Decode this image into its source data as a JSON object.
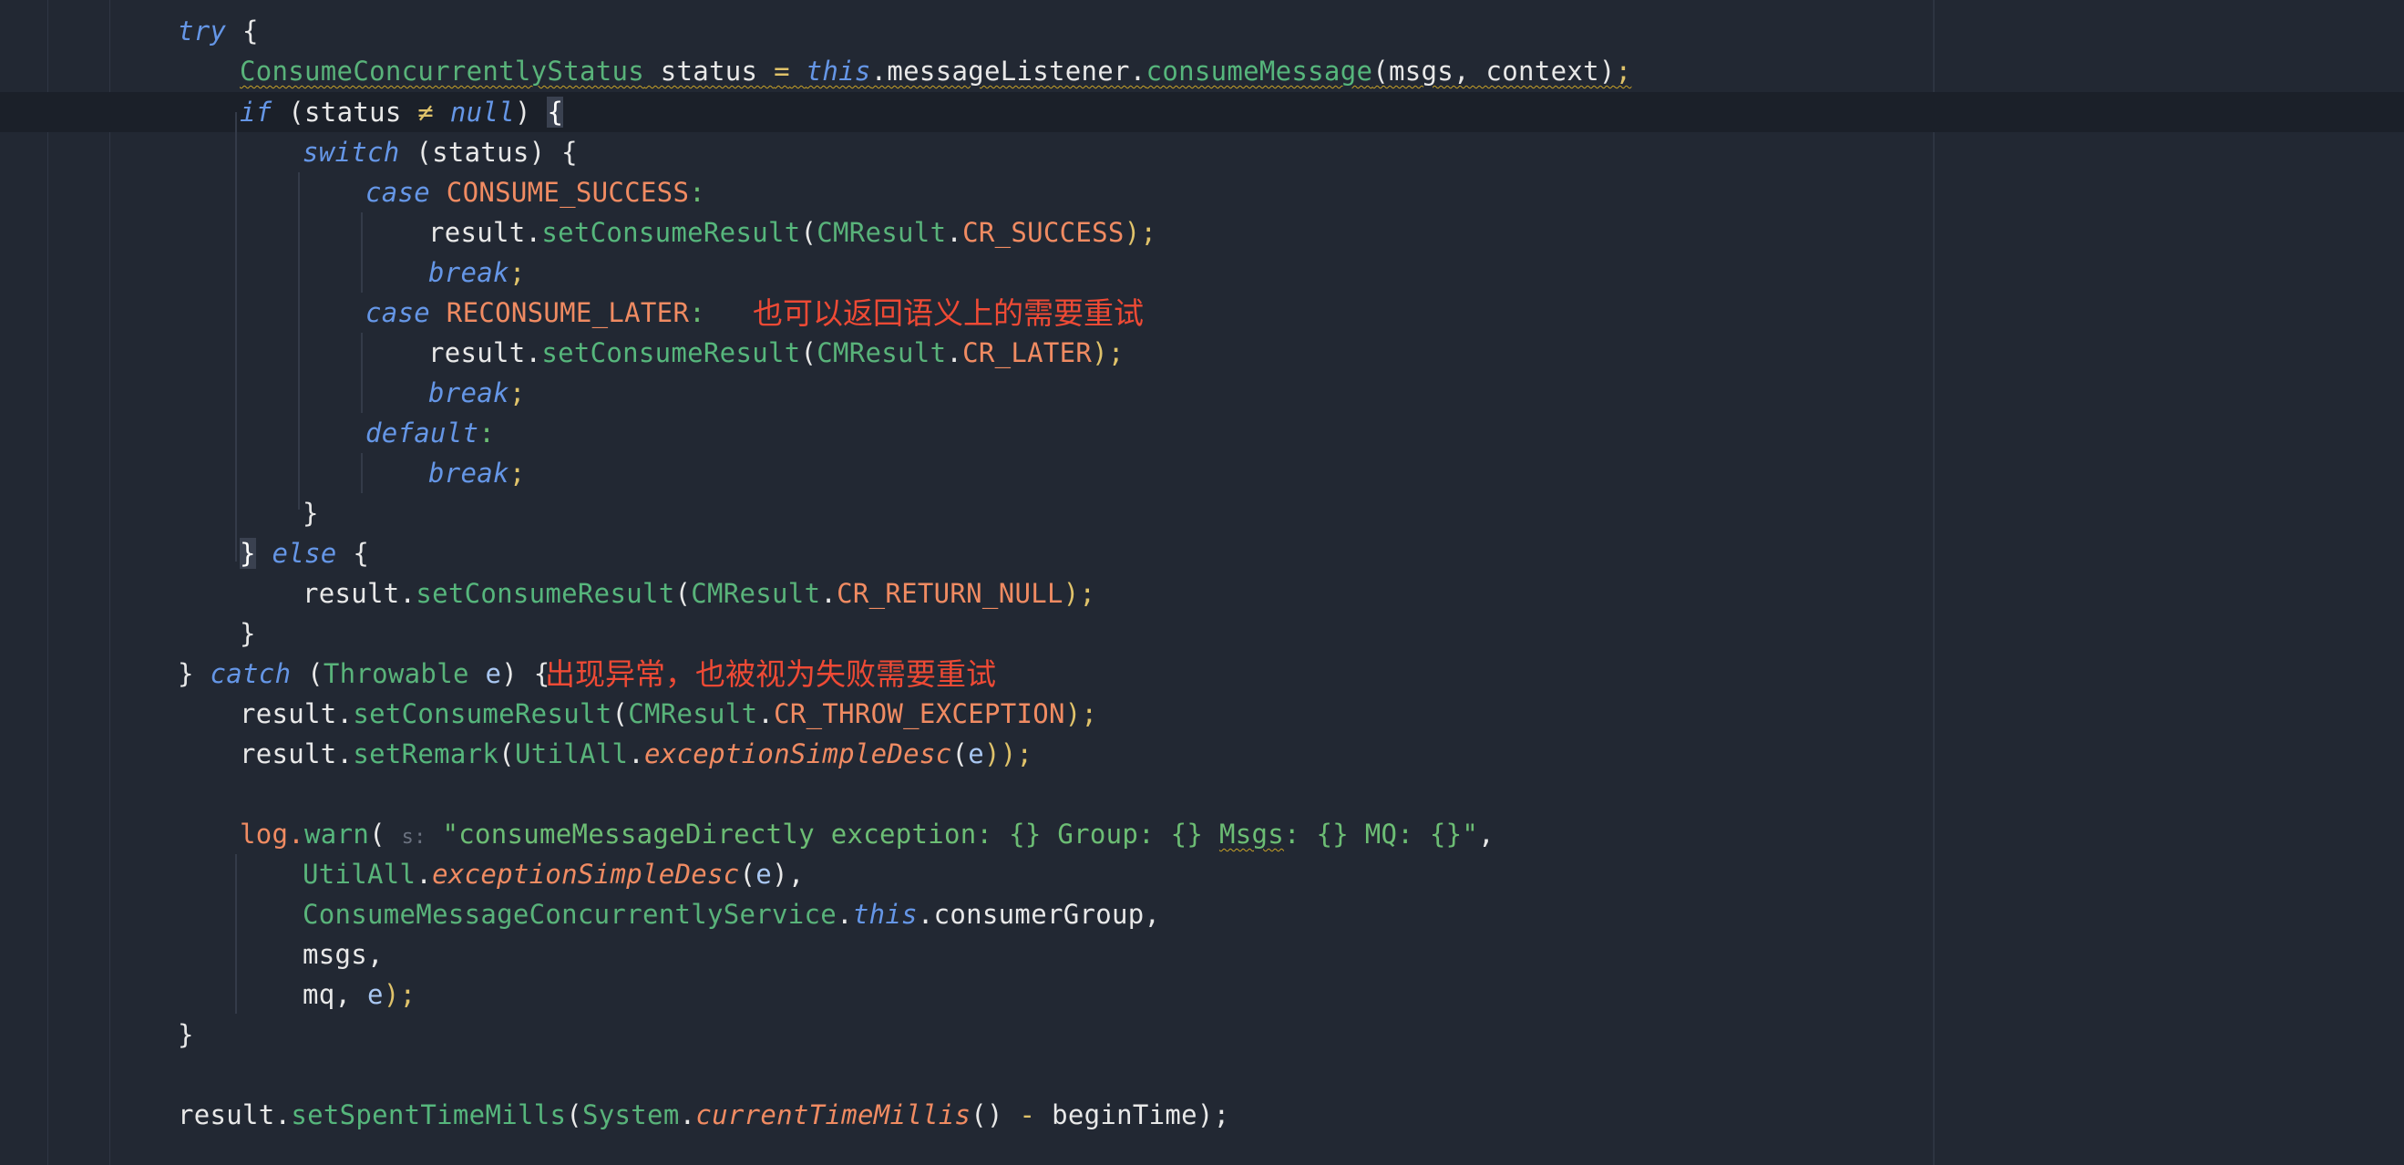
{
  "editor": {
    "colors": {
      "background": "#222833",
      "current_line": "#1b2029",
      "keyword": "#6596e6",
      "type": "#59b37a",
      "constant": "#f08b62",
      "string": "#6cbd74",
      "annotation": "#ee4a35"
    },
    "code": {
      "l1": {
        "kw_try": "try",
        "brace": " {"
      },
      "l2": {
        "type": "ConsumeConcurrentlyStatus",
        "var": " status ",
        "assign": "=",
        "sp": " ",
        "kw_this": "this",
        "member": ".messageListener.",
        "method": "consumeMessage",
        "args": "(msgs, context)",
        "semi": ";"
      },
      "l3": {
        "kw_if": "if",
        "cond_open": " (status ",
        "neq": "≠",
        "sp": " ",
        "kw_null": "null",
        "cond_close": ") ",
        "brace": "{"
      },
      "l4": {
        "kw_switch": "switch",
        "rest": " (status) {"
      },
      "l5": {
        "kw_case": "case",
        "const": " CONSUME_SUCCESS",
        "colon": ":"
      },
      "l6": {
        "obj": "result.",
        "method": "setConsumeResult",
        "open": "(",
        "type": "CMResult",
        "dot": ".",
        "const": "CR_SUCCESS",
        "close": ");"
      },
      "l7": {
        "kw_break": "break",
        "semi": ";"
      },
      "l8": {
        "kw_case": "case",
        "const": " RECONSUME_LATER",
        "colon": ":"
      },
      "l9": {
        "obj": "result.",
        "method": "setConsumeResult",
        "open": "(",
        "type": "CMResult",
        "dot": ".",
        "const": "CR_LATER",
        "close": ");"
      },
      "l10": {
        "kw_break": "break",
        "semi": ";"
      },
      "l11": {
        "kw_default": "default",
        "colon": ":"
      },
      "l12": {
        "kw_break": "break",
        "semi": ";"
      },
      "l13": {
        "brace": "}"
      },
      "l14": {
        "brace": "}",
        "sp": " ",
        "kw_else": "else",
        "brace2": " {"
      },
      "l15": {
        "obj": "result.",
        "method": "setConsumeResult",
        "open": "(",
        "type": "CMResult",
        "dot": ".",
        "const": "CR_RETURN_NULL",
        "close": ");"
      },
      "l16": {
        "brace": "}"
      },
      "l17": {
        "brace": "} ",
        "kw_catch": "catch",
        "open": " (",
        "type": "Throwable",
        "param": " e",
        "close": ") {"
      },
      "l18": {
        "obj": "result.",
        "method": "setConsumeResult",
        "open": "(",
        "type": "CMResult",
        "dot": ".",
        "const": "CR_THROW_EXCEPTION",
        "close": ");"
      },
      "l19": {
        "obj": "result.",
        "method": "setRemark",
        "open": "(",
        "type": "UtilAll",
        "dot": ".",
        "smethod": "exceptionSimpleDesc",
        "paren": "(",
        "param": "e",
        "close": "));"
      },
      "l20": {
        "obj": "log.",
        "method": "warn",
        "open": "( ",
        "hint": "s:",
        "sp": " ",
        "str1": "\"consumeMessageDirectly exception: {} Group: {} ",
        "str_squig": "Msgs",
        "str2": ": {} MQ: {}\"",
        "comma": ","
      },
      "l21": {
        "type": "UtilAll",
        "dot": ".",
        "smethod": "exceptionSimpleDesc",
        "paren": "(",
        "param": "e",
        "close": "),"
      },
      "l22": {
        "type": "ConsumeMessageConcurrentlyService",
        "dot": ".",
        "kw_this": "this",
        "rest": ".consumerGroup,"
      },
      "l23": {
        "text": "msgs,"
      },
      "l24": {
        "text": "mq, ",
        "param": "e",
        "close": ");"
      },
      "l25": {
        "brace": "}"
      },
      "l27": {
        "obj": "result.",
        "method": "setSpentTimeMills",
        "open": "(",
        "type": "System",
        "dot": ".",
        "smethod": "currentTimeMillis",
        "mid": "() ",
        "minus": "-",
        "rest": " beginTime);"
      }
    },
    "annotations": {
      "retry_note": "也可以返回语义上的需要重试",
      "exception_note": "出现异常，也被视为失败需要重试"
    }
  }
}
